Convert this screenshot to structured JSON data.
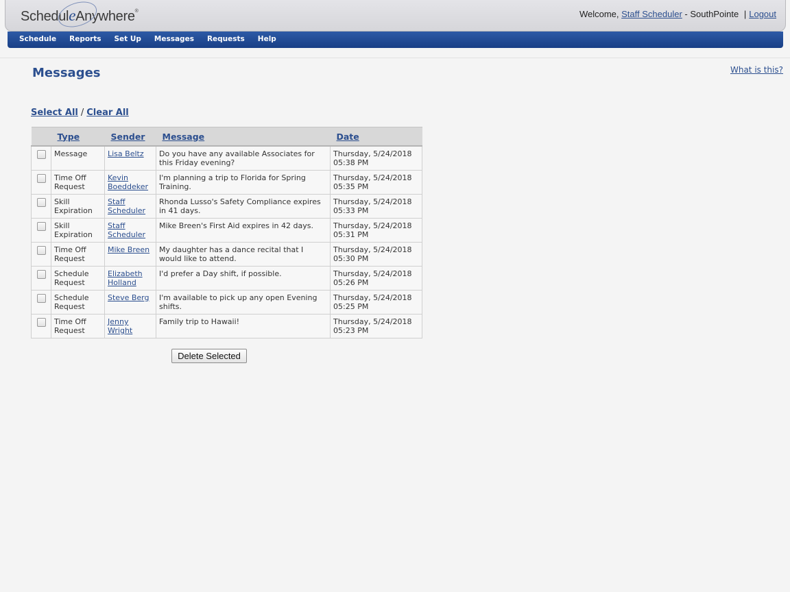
{
  "header": {
    "logo": {
      "part1": "Schedul",
      "part2": "e",
      "part3": "Anywhere",
      "mark": "®"
    },
    "welcome_prefix": "Welcome,",
    "user_name": "Staff Scheduler",
    "separator": "-",
    "location": "SouthPointe",
    "pipe": "|",
    "logout_label": "Logout"
  },
  "nav": {
    "items": [
      {
        "label": "Schedule"
      },
      {
        "label": "Reports"
      },
      {
        "label": "Set Up"
      },
      {
        "label": "Messages"
      },
      {
        "label": "Requests"
      },
      {
        "label": "Help"
      }
    ]
  },
  "page": {
    "title": "Messages",
    "help_link": "What is this?",
    "select_all": "Select All",
    "select_divider": "/",
    "clear_all": "Clear All",
    "delete_button": "Delete Selected"
  },
  "table": {
    "headers": {
      "type": "Type",
      "sender": "Sender",
      "message": "Message",
      "date": "Date"
    },
    "rows": [
      {
        "type": "Message",
        "sender": "Lisa Beltz",
        "message": "Do you have any available Associates for this Friday evening?",
        "date": "Thursday, 5/24/2018",
        "time": "05:38 PM"
      },
      {
        "type": "Time Off Request",
        "sender": "Kevin Boeddeker",
        "message": "I'm planning a trip to Florida for Spring Training.",
        "date": "Thursday, 5/24/2018",
        "time": "05:35 PM"
      },
      {
        "type": "Skill Expiration",
        "sender": "Staff Scheduler",
        "message": "Rhonda Lusso's Safety Compliance expires in 41 days.",
        "date": "Thursday, 5/24/2018",
        "time": "05:33 PM"
      },
      {
        "type": "Skill Expiration",
        "sender": "Staff Scheduler",
        "message": "Mike Breen's First Aid expires in 42 days.",
        "date": "Thursday, 5/24/2018",
        "time": "05:31 PM"
      },
      {
        "type": "Time Off Request",
        "sender": "Mike Breen",
        "message": "My daughter has a dance recital that I would like to attend.",
        "date": "Thursday, 5/24/2018",
        "time": "05:30 PM"
      },
      {
        "type": "Schedule Request",
        "sender": "Elizabeth Holland",
        "message": "I'd prefer a Day shift, if possible.",
        "date": "Thursday, 5/24/2018",
        "time": "05:26 PM"
      },
      {
        "type": "Schedule Request",
        "sender": "Steve Berg",
        "message": "I'm available to pick up any open Evening shifts.",
        "date": "Thursday, 5/24/2018",
        "time": "05:25 PM"
      },
      {
        "type": "Time Off Request",
        "sender": "Jenny Wright",
        "message": "Family trip to Hawaii!",
        "date": "Thursday, 5/24/2018",
        "time": "05:23 PM"
      }
    ]
  }
}
